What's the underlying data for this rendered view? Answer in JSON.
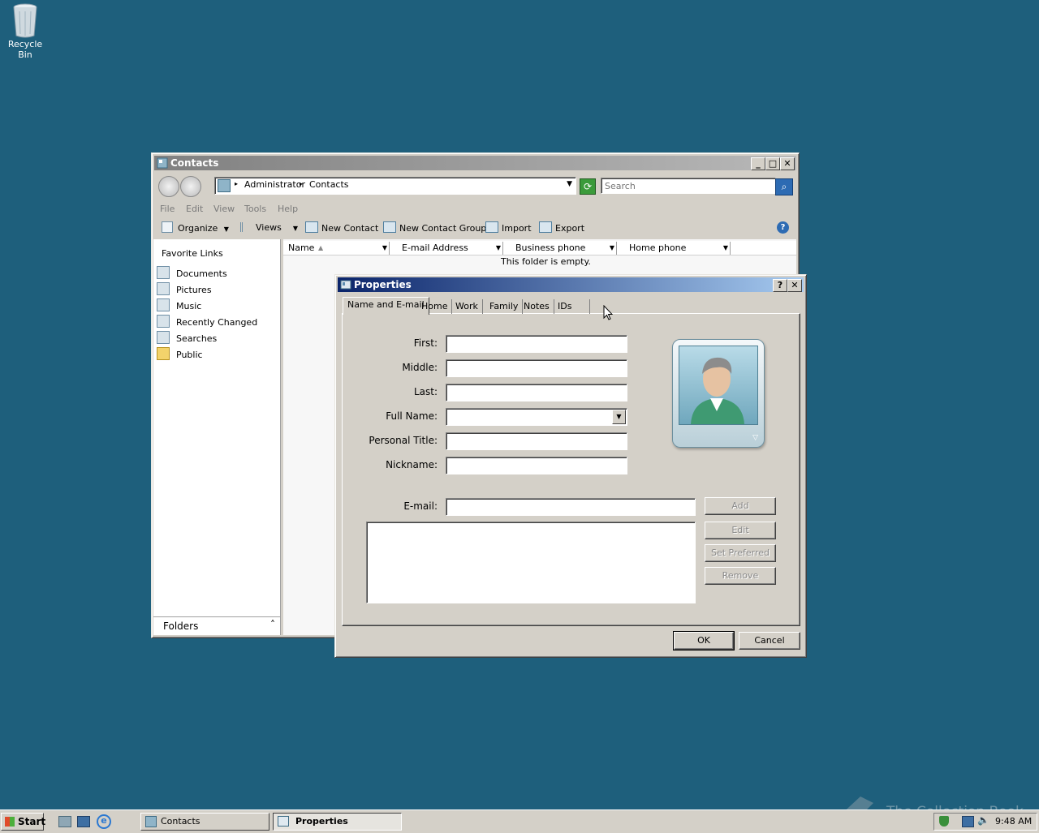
{
  "desktop": {
    "recycle_bin_label": "Recycle Bin",
    "watermark": "The Collection Book"
  },
  "contacts_window": {
    "title": "Contacts",
    "breadcrumb": [
      "Administrator",
      "Contacts"
    ],
    "search_placeholder": "Search",
    "menu": [
      "File",
      "Edit",
      "View",
      "Tools",
      "Help"
    ],
    "toolbar": {
      "organize": "Organize",
      "views": "Views",
      "new_contact": "New Contact",
      "new_contact_group": "New Contact Group",
      "import": "Import",
      "export": "Export"
    },
    "favorite_links_title": "Favorite Links",
    "favorite_links": [
      "Documents",
      "Pictures",
      "Music",
      "Recently Changed",
      "Searches",
      "Public"
    ],
    "folders_label": "Folders",
    "columns": [
      "Name",
      "E-mail Address",
      "Business phone",
      "Home phone"
    ],
    "empty_message": "This folder is empty."
  },
  "properties_dialog": {
    "title": "Properties",
    "tabs": [
      "Name and E-mail",
      "Home",
      "Work",
      "Family",
      "Notes",
      "IDs"
    ],
    "labels": {
      "first": "First:",
      "middle": "Middle:",
      "last": "Last:",
      "full_name": "Full Name:",
      "personal_title": "Personal Title:",
      "nickname": "Nickname:",
      "email": "E-mail:"
    },
    "buttons": {
      "add": "Add",
      "edit": "Edit",
      "set_preferred": "Set Preferred",
      "remove": "Remove",
      "ok": "OK",
      "cancel": "Cancel"
    }
  },
  "taskbar": {
    "start": "Start",
    "tasks": [
      "Contacts",
      "Properties"
    ],
    "clock": "9:48 AM"
  }
}
